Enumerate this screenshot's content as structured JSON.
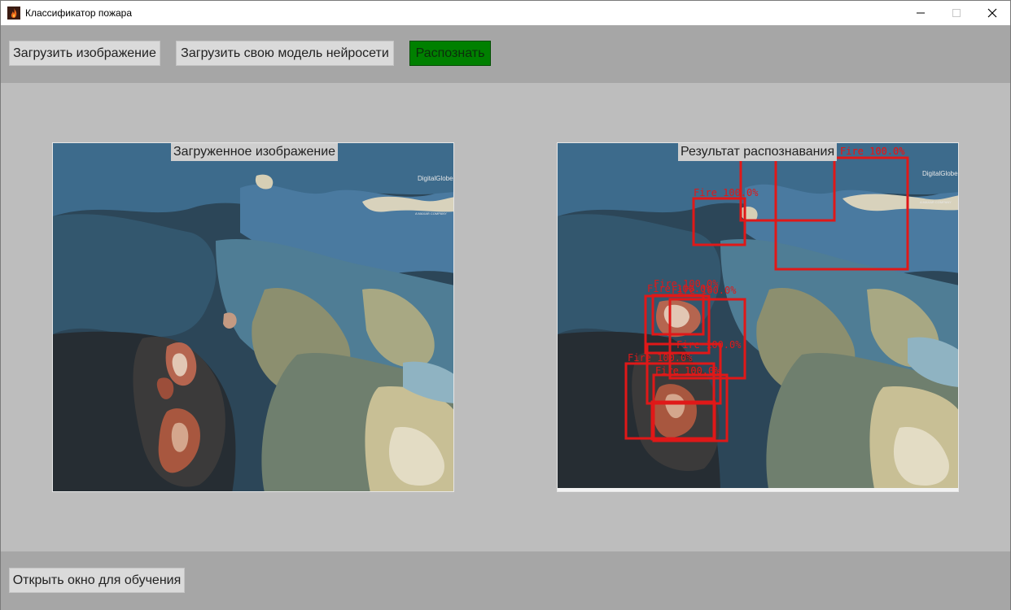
{
  "window": {
    "title": "Классификатор пожара",
    "icon": "fire-icon",
    "controls": [
      "minimize-icon",
      "maximize-icon",
      "close-icon"
    ]
  },
  "toolbar": {
    "load_image_label": "Загрузить изображение",
    "load_model_label": "Загрузить свою модель нейросети",
    "recognize_label": "Распознать",
    "recognize_color": "#008000"
  },
  "panels": {
    "loaded": {
      "label": "Загруженное изображение",
      "watermark": "DigitalGlobe",
      "watermark_sub": "A MAXAR COMPANY"
    },
    "result": {
      "label": "Результат распознавания",
      "watermark": "DigitalGlobe",
      "watermark_sub": "A MAXAR COMPANY",
      "box_color": "#e01818",
      "detections": [
        {
          "label": "Fire 100.0%"
        },
        {
          "label": "Fire 100.0%"
        },
        {
          "label": "Fire 100.0%"
        },
        {
          "label": "Fire 100.0%"
        },
        {
          "label": "Fire 100.0%"
        },
        {
          "label": "Fire 100.0%"
        },
        {
          "label": "Fire 100.0%"
        },
        {
          "label": "Fire 100.0%"
        },
        {
          "label": "Fire 100.0%"
        },
        {
          "label": "Fire 100.0%"
        }
      ]
    }
  },
  "bottom": {
    "open_training_label": "Открыть окно для обучения"
  }
}
